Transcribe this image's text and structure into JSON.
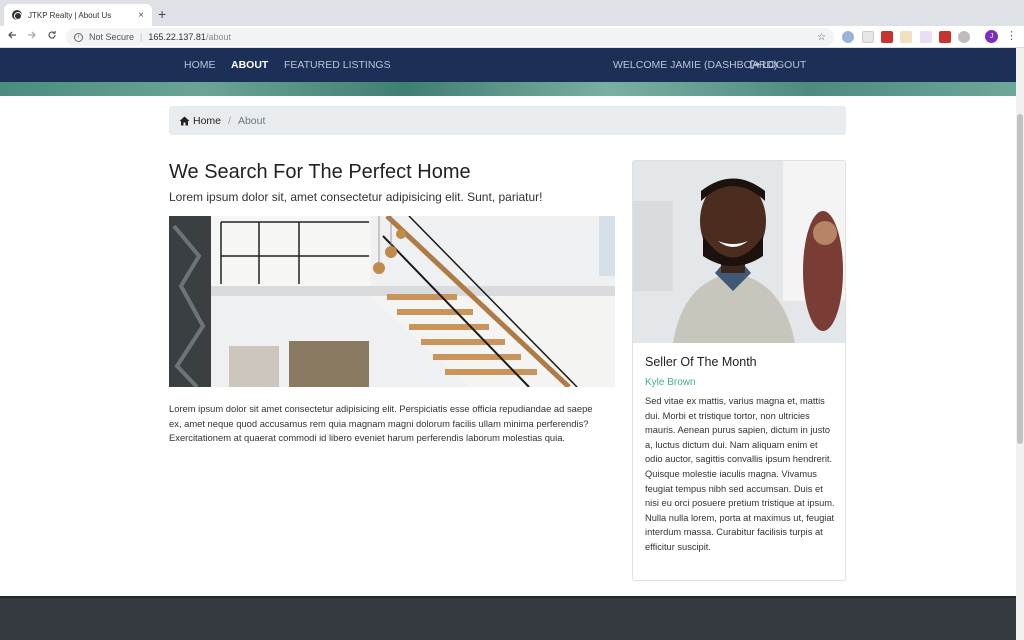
{
  "browser": {
    "tab_title": "JTKP Realty | About Us",
    "close_glyph": "×",
    "new_tab_glyph": "+",
    "security_label": "Not Secure",
    "url_host": "165.22.137.81",
    "url_path": "/about",
    "profile_initial": "J",
    "icons": [
      "back-icon",
      "forward-icon",
      "reload-icon",
      "info-icon",
      "star-icon",
      "menu-icon"
    ]
  },
  "nav": {
    "home": "HOME",
    "about": "ABOUT",
    "featured": "FEATURED LISTINGS",
    "welcome": "WELCOME JAMIE (DASHBOARD)",
    "logout": "LOGOUT",
    "brand_color": "#1b2f57"
  },
  "breadcrumb": {
    "home": "Home",
    "separator": "/",
    "current": "About"
  },
  "about": {
    "heading": "We Search For The Perfect Home",
    "lead": "Lorem ipsum dolor sit, amet consectetur adipisicing elit. Sunt, pariatur!",
    "body": "Lorem ipsum dolor sit amet consectetur adipisicing elit. Perspiciatis esse officia repudiandae ad saepe ex, amet neque quod accusamus rem quia magnam magni dolorum facilis ullam minima perferendis? Exercitationem at quaerat commodi id libero eveniet harum perferendis laborum molestias quia."
  },
  "seller": {
    "title": "Seller Of The Month",
    "name": "Kyle Brown",
    "name_color": "#3fb28f",
    "text": "Sed vitae ex mattis, varius magna et, mattis dui. Morbi et tristique tortor, non ultricies mauris. Aenean purus sapien, dictum in justo a, luctus dictum dui. Nam aliquam enim et odio auctor, sagittis convallis ipsum hendrerit. Quisque molestie iaculis magna. Vivamus feugiat tempus nibh sed accumsan. Duis et nisi eu orci posuere pretium tristique at ipsum. Nulla nulla lorem, porta at maximus ut, feugiat interdum massa. Curabitur facilisis turpis at efficitur suscipit."
  }
}
